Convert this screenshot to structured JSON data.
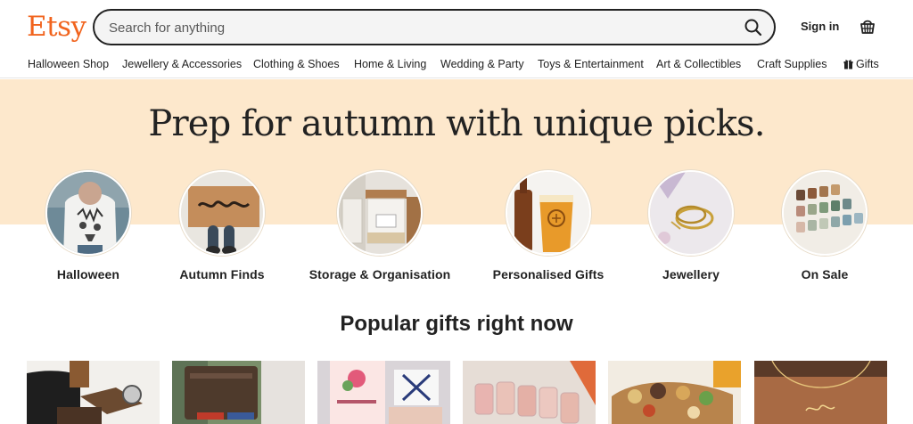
{
  "brand": {
    "logo": "Etsy",
    "color": "#f1641e"
  },
  "search": {
    "placeholder": "Search for anything",
    "icon": "search-icon"
  },
  "header": {
    "signin_label": "Sign in",
    "cart_icon": "basket-icon"
  },
  "nav": {
    "items": [
      "Halloween Shop",
      "Jewellery & Accessories",
      "Clothing & Shoes",
      "Home & Living",
      "Wedding & Party",
      "Toys & Entertainment",
      "Art & Collectibles",
      "Craft Supplies",
      "Gifts"
    ]
  },
  "banner": {
    "headline": "Prep for autumn with unique picks.",
    "color": "#fde8cc"
  },
  "categories": [
    {
      "label": "Halloween"
    },
    {
      "label": "Autumn Finds"
    },
    {
      "label": "Storage & Organisation"
    },
    {
      "label": "Personalised Gifts"
    },
    {
      "label": "Jewellery"
    },
    {
      "label": "On Sale"
    }
  ],
  "popular": {
    "title": "Popular gifts right now"
  }
}
